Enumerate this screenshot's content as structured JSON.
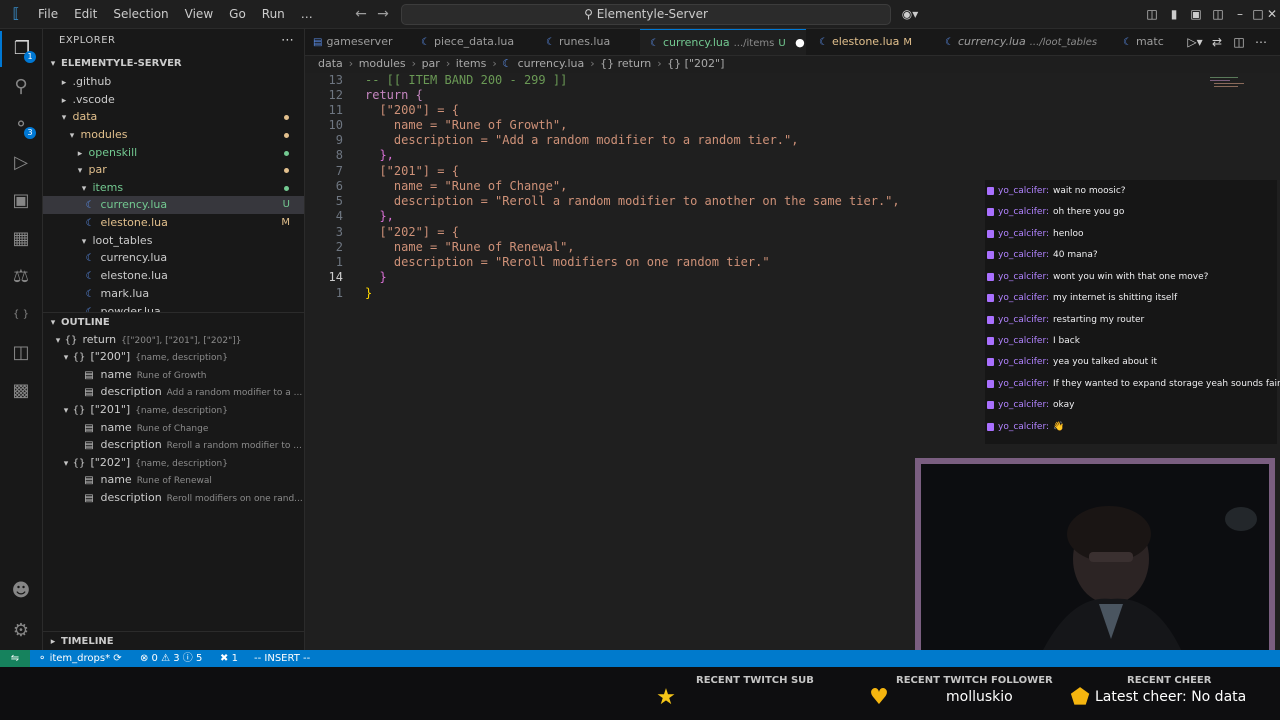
{
  "titlebar": {
    "menu": [
      "File",
      "Edit",
      "Selection",
      "View",
      "Go",
      "Run",
      "…"
    ],
    "search_text": "Elementyle-Server",
    "icons": [
      "vscode-logo-icon",
      "back-arrow-icon",
      "forward-arrow-icon",
      "copilot-icon",
      "layout-icon",
      "minimize-icon",
      "maximize-icon",
      "close-icon"
    ]
  },
  "activitybar": {
    "scm_badge": "1",
    "ext_badge": "3"
  },
  "explorer": {
    "title": "EXPLORER",
    "root": "ELEMENTYLE-SERVER",
    "items": [
      {
        "label": ".github",
        "status": ""
      },
      {
        "label": ".vscode",
        "status": ""
      },
      {
        "label": "data",
        "status": "dot"
      },
      {
        "label": "modules",
        "status": "dot"
      },
      {
        "label": "openskill",
        "status": "dot"
      },
      {
        "label": "par",
        "status": "dot"
      },
      {
        "label": "items",
        "status": "dot"
      },
      {
        "label": "currency.lua",
        "status": "U"
      },
      {
        "label": "elestone.lua",
        "status": "M"
      },
      {
        "label": "loot_tables",
        "status": ""
      },
      {
        "label": "currency.lua",
        "status": ""
      },
      {
        "label": "elestone.lua",
        "status": ""
      },
      {
        "label": "mark.lua",
        "status": ""
      },
      {
        "label": "powder.lua",
        "status": ""
      }
    ]
  },
  "outline": {
    "title": "OUTLINE",
    "items": [
      {
        "label": "return",
        "detail": "{[\"200\"], [\"201\"], [\"202\"]}"
      },
      {
        "label": "[\"200\"]",
        "detail": "{name, description}"
      },
      {
        "label": "name",
        "detail": "Rune of Growth"
      },
      {
        "label": "description",
        "detail": "Add a random modifier to a ..."
      },
      {
        "label": "[\"201\"]",
        "detail": "{name, description}"
      },
      {
        "label": "name",
        "detail": "Rune of Change"
      },
      {
        "label": "description",
        "detail": "Reroll a random modifier to ..."
      },
      {
        "label": "[\"202\"]",
        "detail": "{name, description}"
      },
      {
        "label": "name",
        "detail": "Rune of Renewal"
      },
      {
        "label": "description",
        "detail": "Reroll modifiers on one rand..."
      }
    ]
  },
  "timeline": {
    "title": "TIMELINE"
  },
  "tabs": [
    {
      "label": "gameserver",
      "sub": "",
      "flag": ""
    },
    {
      "label": "piece_data.lua",
      "sub": "",
      "flag": ""
    },
    {
      "label": "runes.lua",
      "sub": "",
      "flag": ""
    },
    {
      "label": "currency.lua",
      "sub": ".../items",
      "flag": "U"
    },
    {
      "label": "elestone.lua",
      "sub": "",
      "flag": "M"
    },
    {
      "label": "currency.lua",
      "sub": ".../loot_tables",
      "flag": ""
    },
    {
      "label": "matc",
      "sub": "",
      "flag": ""
    }
  ],
  "breadcrumb": [
    "data",
    "modules",
    "par",
    "items",
    "currency.lua",
    "{} return",
    "{} [\"202\"]"
  ],
  "editor": {
    "gutter": [
      "13",
      "12",
      "11",
      "10",
      "9",
      "8",
      "7",
      "6",
      "5",
      "4",
      "3",
      "2",
      "1",
      "14",
      "1"
    ],
    "lines": [
      "-- [[ ITEM BAND 200 - 299 ]]",
      "return {",
      "  [\"200\"] = {",
      "    name = \"Rune of Growth\",",
      "    description = \"Add a random modifier to a random tier.\",",
      "  },",
      "  [\"201\"] = {",
      "    name = \"Rune of Change\",",
      "    description = \"Reroll a random modifier to another on the same tier.\",",
      "  },",
      "  [\"202\"] = {",
      "    name = \"Rune of Renewal\",",
      "    description = \"Reroll modifiers on one random tier.\"",
      "  }",
      "}"
    ]
  },
  "chat": {
    "messages": [
      {
        "user": "yo_calcifer:",
        "text": "wait no moosic?"
      },
      {
        "user": "yo_calcifer:",
        "text": "oh there you go"
      },
      {
        "user": "yo_calcifer:",
        "text": "henloo"
      },
      {
        "user": "yo_calcifer:",
        "text": "40 mana?"
      },
      {
        "user": "yo_calcifer:",
        "text": "wont you win with that one move?"
      },
      {
        "user": "yo_calcifer:",
        "text": "my internet is shitting itself"
      },
      {
        "user": "yo_calcifer:",
        "text": "restarting my router"
      },
      {
        "user": "yo_calcifer:",
        "text": "I back"
      },
      {
        "user": "yo_calcifer:",
        "text": "yea you talked about it"
      },
      {
        "user": "yo_calcifer:",
        "text": "If they wanted to expand storage yeah sounds fair"
      },
      {
        "user": "yo_calcifer:",
        "text": "okay"
      },
      {
        "user": "yo_calcifer:",
        "text": "👋"
      }
    ]
  },
  "statusbar": {
    "branch": "item_drops*",
    "problems": "⊗ 0 ⚠ 3 ⓘ 5",
    "ports": "1",
    "mode": "-- INSERT --"
  },
  "overlay": {
    "sub_title": "RECENT TWITCH SUB",
    "sub_value": "",
    "follower_title": "RECENT TWITCH FOLLOWER",
    "follower_value": "molluskio",
    "cheer_title": "RECENT CHEER",
    "cheer_value": "Latest cheer: No data"
  },
  "colors": {
    "accent": "#0078d4",
    "statusbar": "#007acc",
    "modified": "#e2c08d",
    "untracked": "#73c991",
    "twitch": "#a970ff"
  }
}
